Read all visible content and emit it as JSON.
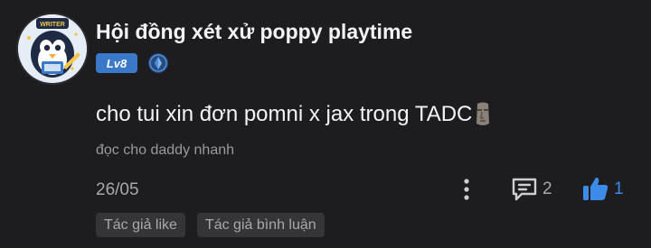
{
  "user": {
    "name": "Hội đồng xét xử poppy playtime",
    "level": "Lv8",
    "avatar_badge_text": "WRITER"
  },
  "comment": {
    "text": "cho tui xin đơn pomni x jax trong TADC",
    "sub_text": "đọc cho daddy nhanh",
    "date": "26/05",
    "reply_count": "2",
    "like_count": "1"
  },
  "icons": {
    "verified": "verified-shield-icon",
    "emoji": "moai-emoji-icon",
    "more": "more-vertical-icon",
    "comment": "comment-icon",
    "like": "thumbs-up-icon"
  },
  "tags": [
    {
      "label": "Tác giả like"
    },
    {
      "label": "Tác giả bình luận"
    }
  ],
  "colors": {
    "background": "#1d1d1f",
    "level_badge": "#3a79c9",
    "like_active": "#3d8be8",
    "tag_bg": "#353538"
  }
}
